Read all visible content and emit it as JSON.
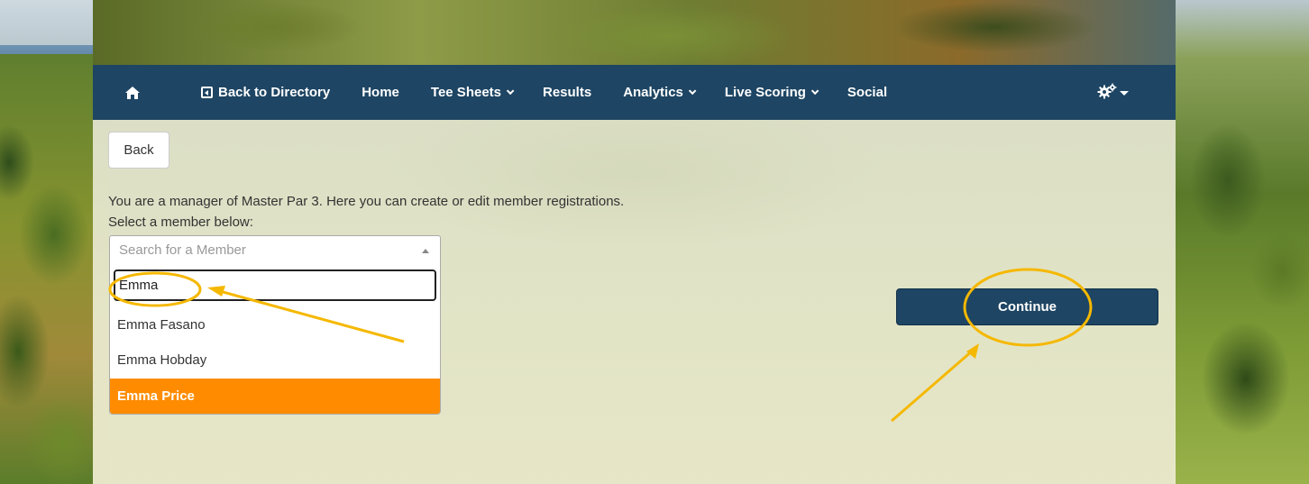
{
  "navbar": {
    "home_icon": "home-icon",
    "back_to_directory": "Back to Directory",
    "home": "Home",
    "tee_sheets": "Tee Sheets",
    "results": "Results",
    "analytics": "Analytics",
    "live_scoring": "Live Scoring",
    "social": "Social",
    "settings_icon": "gears-icon"
  },
  "content": {
    "back_button": "Back",
    "info_text": "You are a manager of Master Par 3. Here you can create or edit member registrations.",
    "select_label": "Select a member below:",
    "select_placeholder": "Search for a Member",
    "search_value": "Emma",
    "results": [
      "Emma Fasano",
      "Emma Hobday",
      "Emma Price"
    ],
    "highlighted_result": "Emma Price",
    "continue_button": "Continue"
  },
  "colors": {
    "navbar": "#1e4563",
    "highlight": "#ff8c00",
    "annotation": "#f5b800"
  }
}
